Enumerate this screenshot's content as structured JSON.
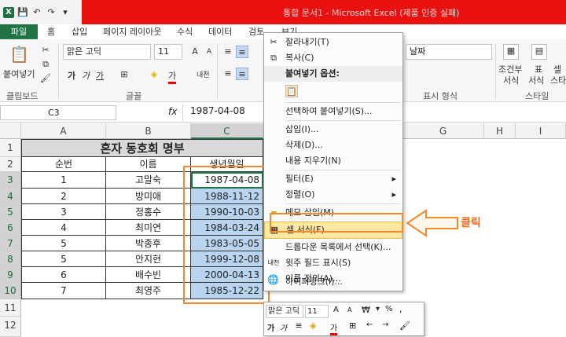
{
  "window": {
    "title": "통합 문서1 - Microsoft Excel (제품 인증 실패)"
  },
  "qat": {
    "logo": "X",
    "save": "💾",
    "undo": "↶",
    "redo": "↷",
    "more": "▾"
  },
  "tabs": [
    "파일",
    "홈",
    "삽입",
    "페이지 레이아웃",
    "수식",
    "데이터",
    "검토",
    "보기"
  ],
  "ribbon": {
    "paste_label": "붙여넣기",
    "clipboard_group": "클립보드",
    "font_name": "맑은 고딕",
    "font_size": "11",
    "font_group": "글꼴",
    "number_format": "날짜",
    "number_group": "표시 형식",
    "style_group": "스타일",
    "cond_format": "조건부",
    "cond_format2": "서식",
    "as_table": "표",
    "as_table2": "서식",
    "cell_style": "셀",
    "cell_style2": "스타",
    "bold": "가",
    "italic": "가",
    "underline": "가",
    "font_color_glyph": "가",
    "korean_glyph": "내천"
  },
  "formula_bar": {
    "namebox": "C3",
    "fx": "fx",
    "value": "1987-04-08"
  },
  "columns": [
    "A",
    "B",
    "C",
    "D",
    "E",
    "F",
    "G",
    "H",
    "I"
  ],
  "rows": [
    "1",
    "2",
    "3",
    "4",
    "5",
    "6",
    "7",
    "8",
    "9",
    "10",
    "11",
    "12"
  ],
  "sheet": {
    "title": "혼자 동호회 명부",
    "headers": [
      "순번",
      "이름",
      "생년월일"
    ],
    "records": [
      {
        "no": "1",
        "name": "고말숙",
        "birth": "1987-04-08"
      },
      {
        "no": "2",
        "name": "방미애",
        "birth": "1988-11-12"
      },
      {
        "no": "3",
        "name": "정홍수",
        "birth": "1990-10-03"
      },
      {
        "no": "4",
        "name": "최미연",
        "birth": "1984-03-24"
      },
      {
        "no": "5",
        "name": "박종후",
        "birth": "1983-05-05"
      },
      {
        "no": "5",
        "name": "안지현",
        "birth": "1999-12-08"
      },
      {
        "no": "6",
        "name": "배수빈",
        "birth": "2000-04-13"
      },
      {
        "no": "7",
        "name": "최영주",
        "birth": "1985-12-22"
      }
    ]
  },
  "context_menu": {
    "cut": "잘라내기(T)",
    "copy": "복사(C)",
    "paste_options": "붙여넣기 옵션:",
    "paste_special": "선택하여 붙여넣기(S)...",
    "insert": "삽입(I)...",
    "delete": "삭제(D)...",
    "clear": "내용 지우기(N)",
    "filter": "필터(E)",
    "sort": "정렬(O)",
    "comment": "메모 삽입(M)",
    "format_cells": "셀 서식(F)...",
    "dropdown": "드롭다운 목록에서 선택(K)...",
    "phonetic": "윗주 필드 표시(S)",
    "define_name": "이름 정의(A)...",
    "hyperlink": "하이퍼링크(I)..."
  },
  "mini_toolbar": {
    "font": "맑은 고딕",
    "size": "11",
    "bold": "가",
    "italic": "가",
    "fontcolor": "가"
  },
  "annotation": {
    "label": "클릭",
    "color": "#f28a2d"
  },
  "colors": {
    "title_bar": "#e8110f",
    "file_tab": "#217346",
    "selection": "#b8d4ee",
    "menu_highlight": "#fce7a3",
    "title_fill": "#d9d9d9"
  }
}
